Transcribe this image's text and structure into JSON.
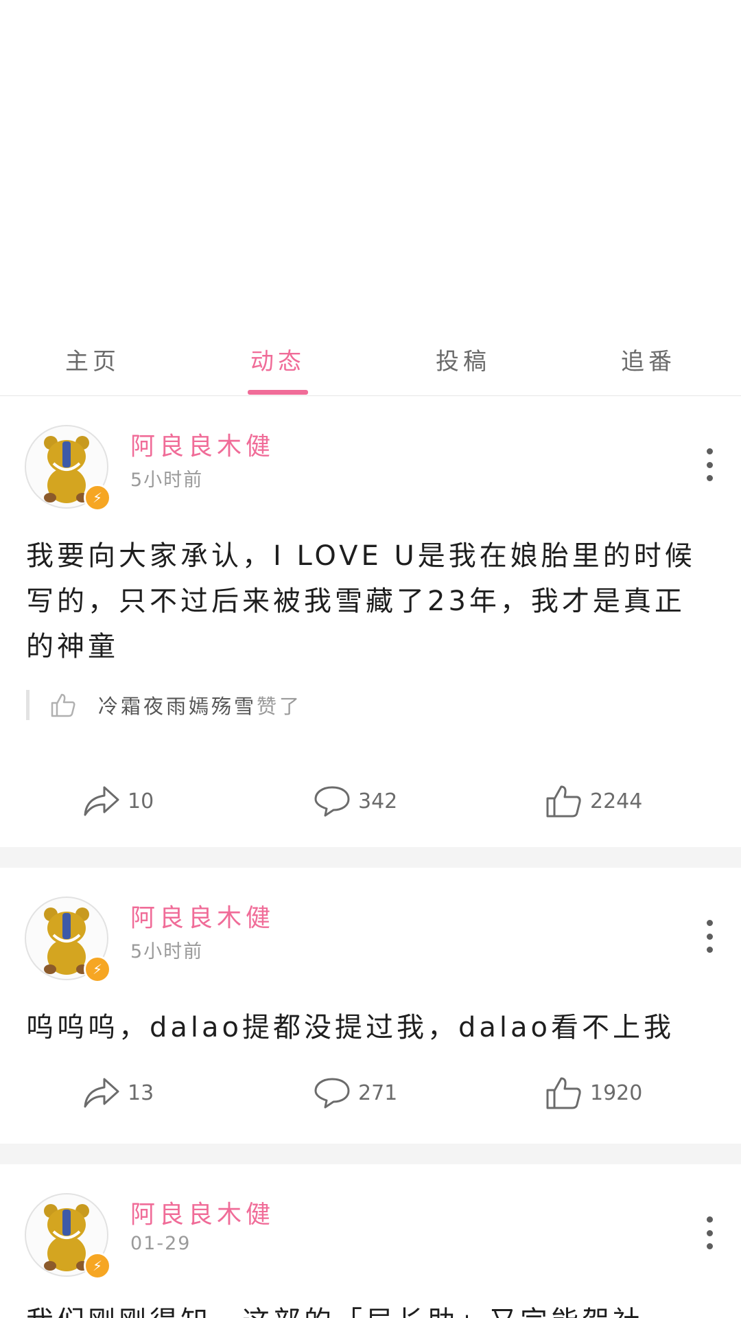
{
  "tabs": [
    {
      "label": "主页",
      "active": false
    },
    {
      "label": "动态",
      "active": true
    },
    {
      "label": "投稿",
      "active": false
    },
    {
      "label": "追番",
      "active": false
    }
  ],
  "posts": [
    {
      "username": "阿良良木健",
      "time": "5小时前",
      "content": "我要向大家承认，I LOVE U是我在娘胎里的时候写的，只不过后来被我雪藏了23年，我才是真正的神童",
      "liked_by": {
        "names": "冷霜夜雨嫣殇雪",
        "suffix": "赞了"
      },
      "shares": "10",
      "comments": "342",
      "likes": "2244"
    },
    {
      "username": "阿良良木健",
      "time": "5小时前",
      "content": "呜呜呜，dalao提都没提过我，dalao看不上我",
      "shares": "13",
      "comments": "271",
      "likes": "1920"
    },
    {
      "username": "阿良良木健",
      "time": "01-29",
      "content": "我们刚刚得知，这部的「局长助」又完能贺社"
    }
  ],
  "colors": {
    "accent": "#f06c98",
    "badge": "#f6a623",
    "separator": "#f4f4f4"
  },
  "icons": {
    "share": "share-icon",
    "comment": "comment-icon",
    "like": "thumb-up-icon",
    "more": "more-vertical-icon",
    "badge": "lightning-icon"
  }
}
